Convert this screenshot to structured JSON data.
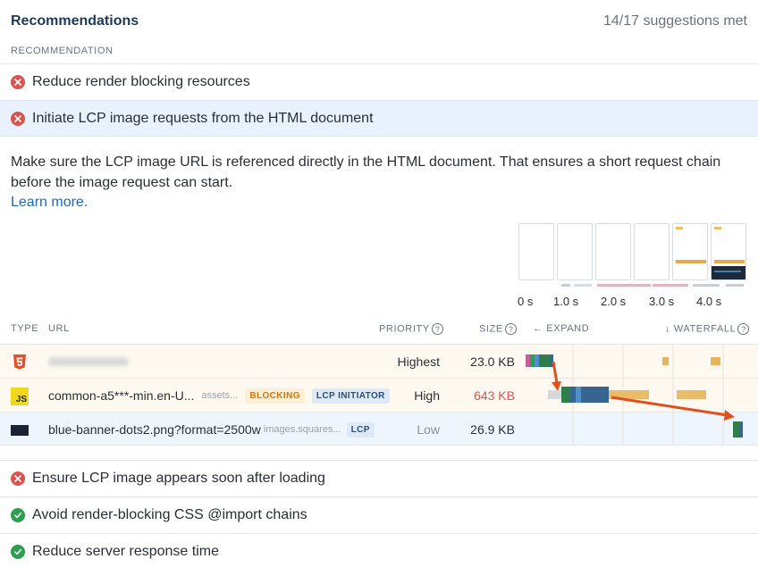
{
  "header": {
    "title": "Recommendations",
    "met": "14/17 suggestions met",
    "column": "RECOMMENDATION"
  },
  "recommendations": [
    {
      "label": "Reduce render blocking resources",
      "status": "fail"
    },
    {
      "label": "Initiate LCP image requests from the HTML document",
      "status": "fail",
      "expanded": true
    },
    {
      "label": "Ensure LCP image appears soon after loading",
      "status": "fail"
    },
    {
      "label": "Avoid render-blocking CSS @import chains",
      "status": "pass"
    },
    {
      "label": "Reduce server response time",
      "status": "pass"
    }
  ],
  "detail": {
    "description": "Make sure the LCP image URL is referenced directly in the HTML document. That ensures a short request chain before the image request can start.",
    "learn_more": "Learn more."
  },
  "filmstrip": {
    "times": [
      "0 s",
      "1.0 s",
      "2.0 s",
      "3.0 s",
      "4.0 s"
    ]
  },
  "table": {
    "headers": {
      "type": "TYPE",
      "url": "URL",
      "priority": "PRIORITY",
      "size": "SIZE",
      "expand": "← EXPAND",
      "waterfall": "↓ WATERFALL"
    },
    "rows": [
      {
        "type": "html",
        "type_label": "5",
        "url": "",
        "priority": "Highest",
        "size": "23.0 KB"
      },
      {
        "type": "js",
        "type_label": "JS",
        "url": "common-a5***-min.en-U...",
        "host": "assets...",
        "tags": [
          "BLOCKING",
          "LCP INITIATOR"
        ],
        "priority": "High",
        "size": "643 KB"
      },
      {
        "type": "image",
        "url": "blue-banner-dots2.png?format=2500w",
        "host": "images.squares...",
        "tags": [
          "LCP"
        ],
        "priority": "Low",
        "size": "26.9 KB"
      }
    ]
  },
  "colors": {
    "fail": "#d9534f",
    "pass": "#2e9e4f",
    "accent": "#1f6bb5",
    "arrow": "#e0501e"
  },
  "icons": [
    "close-circle-icon",
    "check-circle-icon",
    "html5-icon",
    "javascript-icon",
    "image-icon",
    "help-icon"
  ]
}
